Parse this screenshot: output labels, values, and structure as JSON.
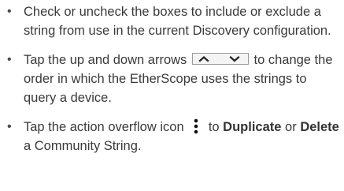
{
  "items": [
    {
      "text": "Check or uncheck the boxes to include or exclude a string from use in the current Discovery configuration."
    },
    {
      "before": "Tap the up and down arrows",
      "after": "to change the order in which the EtherScope uses the strings to query a device."
    },
    {
      "before": "Tap the action overflow icon",
      "mid1": "to",
      "bold1": "Duplicate",
      "mid2": "or",
      "bold2": "Delete",
      "after": "a Community String."
    }
  ],
  "icons": {
    "arrows": "up-down-arrows-icon",
    "overflow": "action-overflow-icon"
  }
}
